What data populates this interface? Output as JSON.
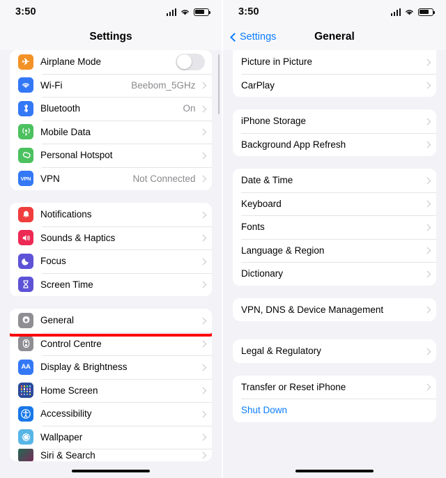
{
  "left": {
    "statusbar": {
      "time": "3:50",
      "signal_icon": "cellular-bars-icon",
      "wifi_icon": "wifi-icon",
      "battery_icon": "battery-icon"
    },
    "nav": {
      "title": "Settings"
    },
    "groups": [
      {
        "id": "connectivity",
        "rows": [
          {
            "label": "Airplane Mode",
            "icon": "airplane-icon",
            "icon_color": "#F39227",
            "glyph": "✈",
            "accessory": "toggle",
            "toggle_on": false
          },
          {
            "label": "Wi-Fi",
            "icon": "wifi-icon",
            "icon_color": "#3478F6",
            "glyph": "◑",
            "value": "Beebom_5GHz",
            "accessory": "chevron"
          },
          {
            "label": "Bluetooth",
            "icon": "bluetooth-icon",
            "icon_color": "#3478F6",
            "glyph": "ᛦ",
            "value": "On",
            "accessory": "chevron"
          },
          {
            "label": "Mobile Data",
            "icon": "mobile-data-icon",
            "icon_color": "#4CC15F",
            "glyph": "ⓦ",
            "accessory": "chevron"
          },
          {
            "label": "Personal Hotspot",
            "icon": "personal-hotspot-icon",
            "icon_color": "#4CC15F",
            "glyph": "⚭",
            "accessory": "chevron"
          },
          {
            "label": "VPN",
            "icon": "vpn-icon",
            "icon_color": "#3478F6",
            "glyph": "VPN",
            "value": "Not Connected",
            "accessory": "chevron"
          }
        ]
      },
      {
        "id": "alerts",
        "rows": [
          {
            "label": "Notifications",
            "icon": "notifications-bell-icon",
            "icon_color": "#F03E3E",
            "glyph": "🔔",
            "accessory": "chevron"
          },
          {
            "label": "Sounds & Haptics",
            "icon": "sounds-speaker-icon",
            "icon_color": "#EC2A53",
            "glyph": "🔊",
            "accessory": "chevron"
          },
          {
            "label": "Focus",
            "icon": "focus-moon-icon",
            "icon_color": "#5E53D6",
            "glyph": "☾",
            "accessory": "chevron"
          },
          {
            "label": "Screen Time",
            "icon": "screen-time-hourglass-icon",
            "icon_color": "#5E53D6",
            "glyph": "⌛",
            "accessory": "chevron"
          }
        ]
      },
      {
        "id": "system",
        "rows": [
          {
            "label": "General",
            "icon": "gear-icon",
            "icon_color": "#8E8E93",
            "glyph": "⚙",
            "accessory": "chevron",
            "highlighted": true
          },
          {
            "label": "Control Centre",
            "icon": "control-centre-icon",
            "icon_color": "#8E8E93",
            "glyph": "☷",
            "accessory": "chevron"
          },
          {
            "label": "Display & Brightness",
            "icon": "display-brightness-icon",
            "icon_color": "#3478F6",
            "glyph": "AA",
            "accessory": "chevron"
          },
          {
            "label": "Home Screen",
            "icon": "home-screen-icon",
            "icon_color": "#2A4A9B",
            "glyph": "grid",
            "accessory": "chevron"
          },
          {
            "label": "Accessibility",
            "icon": "accessibility-icon",
            "icon_color": "#1878E8",
            "glyph": "♿",
            "accessory": "chevron"
          },
          {
            "label": "Wallpaper",
            "icon": "wallpaper-icon",
            "icon_color": "#57B6E6",
            "glyph": "✽",
            "accessory": "chevron"
          },
          {
            "label": "Siri & Search",
            "icon": "siri-icon",
            "icon_color": "#1F6B52",
            "glyph": "●",
            "accessory": "chevron",
            "partial": true
          }
        ]
      }
    ]
  },
  "right": {
    "statusbar": {
      "time": "3:50",
      "signal_icon": "cellular-bars-icon",
      "wifi_icon": "wifi-icon",
      "battery_icon": "battery-icon"
    },
    "nav": {
      "back_label": "Settings",
      "title": "General",
      "back_icon": "chevron-left-icon"
    },
    "groups": [
      {
        "id": "media",
        "flush_top": true,
        "rows": [
          {
            "label": "Picture in Picture",
            "accessory": "chevron"
          },
          {
            "label": "CarPlay",
            "accessory": "chevron"
          }
        ]
      },
      {
        "id": "storage",
        "rows": [
          {
            "label": "iPhone Storage",
            "accessory": "chevron"
          },
          {
            "label": "Background App Refresh",
            "accessory": "chevron"
          }
        ]
      },
      {
        "id": "locale",
        "rows": [
          {
            "label": "Date & Time",
            "accessory": "chevron"
          },
          {
            "label": "Keyboard",
            "accessory": "chevron"
          },
          {
            "label": "Fonts",
            "accessory": "chevron"
          },
          {
            "label": "Language & Region",
            "accessory": "chevron"
          },
          {
            "label": "Dictionary",
            "accessory": "chevron"
          }
        ]
      },
      {
        "id": "vpn-management",
        "rows": [
          {
            "label": "VPN, DNS & Device Management",
            "accessory": "chevron",
            "highlighted": true
          }
        ]
      },
      {
        "id": "legal",
        "rows": [
          {
            "label": "Legal & Regulatory",
            "accessory": "chevron"
          }
        ]
      },
      {
        "id": "reset",
        "rows": [
          {
            "label": "Transfer or Reset iPhone",
            "accessory": "chevron"
          },
          {
            "label": "Shut Down",
            "accessory": "none",
            "style": "blue"
          }
        ]
      }
    ]
  },
  "highlight_color": "#FB0007"
}
